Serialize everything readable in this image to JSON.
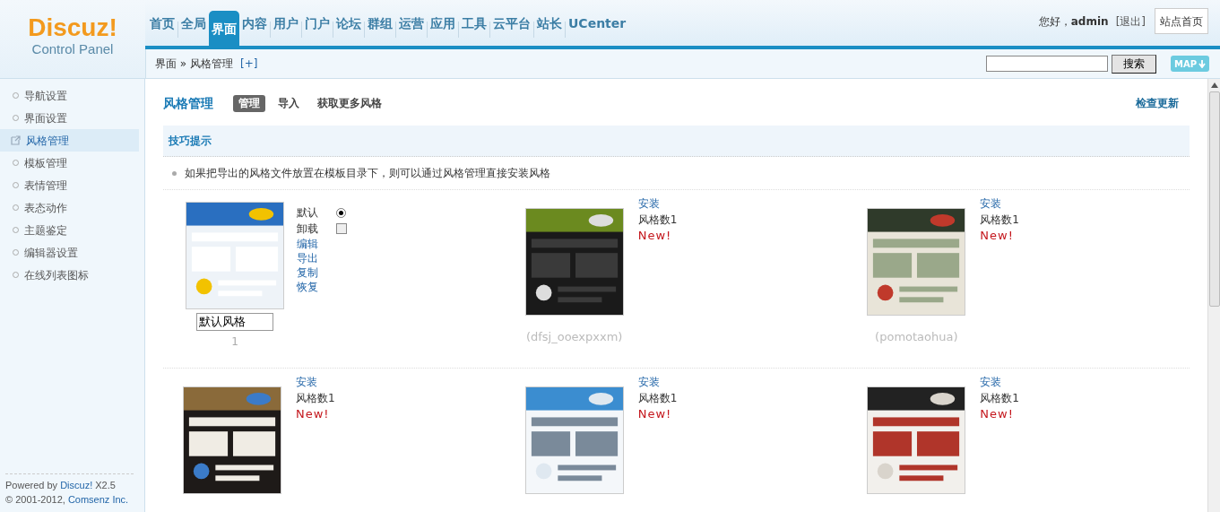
{
  "logo": {
    "title": "Discuz!",
    "subtitle": "Control Panel"
  },
  "nav": [
    {
      "label": "首页",
      "selected": false
    },
    {
      "label": "全局",
      "selected": false
    },
    {
      "label": "界面",
      "selected": true
    },
    {
      "label": "内容",
      "selected": false
    },
    {
      "label": "用户",
      "selected": false
    },
    {
      "label": "门户",
      "selected": false
    },
    {
      "label": "论坛",
      "selected": false
    },
    {
      "label": "群组",
      "selected": false
    },
    {
      "label": "运营",
      "selected": false
    },
    {
      "label": "应用",
      "selected": false
    },
    {
      "label": "工具",
      "selected": false
    },
    {
      "label": "云平台",
      "selected": false
    },
    {
      "label": "站长",
      "selected": false
    },
    {
      "label": "UCenter",
      "selected": false
    }
  ],
  "user": {
    "greeting": "您好，",
    "name": "admin",
    "logout": "[退出]",
    "site_home": "站点首页"
  },
  "breadcrumb": {
    "path": "界面 » 风格管理",
    "add": "[+]"
  },
  "search": {
    "button": "搜索",
    "map": "MAP"
  },
  "sidebar": {
    "items": [
      {
        "label": "导航设置",
        "selected": false
      },
      {
        "label": "界面设置",
        "selected": false
      },
      {
        "label": "风格管理",
        "selected": true
      },
      {
        "label": "模板管理",
        "selected": false
      },
      {
        "label": "表情管理",
        "selected": false
      },
      {
        "label": "表态动作",
        "selected": false
      },
      {
        "label": "主题鉴定",
        "selected": false
      },
      {
        "label": "编辑器设置",
        "selected": false
      },
      {
        "label": "在线列表图标",
        "selected": false
      }
    ],
    "footer": {
      "powered": "Powered by",
      "product": "Discuz!",
      "version": "X2.5",
      "copyright": "© 2001-2012,",
      "company": "Comsenz Inc."
    }
  },
  "page": {
    "title": "风格管理",
    "tabs": [
      {
        "label": "管理",
        "selected": true
      },
      {
        "label": "导入",
        "selected": false
      },
      {
        "label": "获取更多风格",
        "selected": false
      }
    ],
    "check_update": "检查更新"
  },
  "tips": {
    "title": "技巧提示",
    "items": [
      "如果把导出的风格文件放置在模板目录下，则可以通过风格管理直接安装风格"
    ]
  },
  "styles": [
    {
      "kind": "installed",
      "default_label": "默认",
      "default_selected": true,
      "uninstall_label": "卸载",
      "uninstall_checked": false,
      "actions": [
        "编辑",
        "导出",
        "复制",
        "恢复"
      ],
      "name": "默认风格",
      "id": "1"
    },
    {
      "kind": "available",
      "install": "安装",
      "count": "风格数1",
      "badge": "New!",
      "caption": "(dfsj_ooexpxxm)"
    },
    {
      "kind": "available",
      "install": "安装",
      "count": "风格数1",
      "badge": "New!",
      "caption": "(pomotaohua)"
    },
    {
      "kind": "available",
      "install": "安装",
      "count": "风格数1",
      "badge": "New!"
    },
    {
      "kind": "available",
      "install": "安装",
      "count": "风格数1",
      "badge": "New!"
    },
    {
      "kind": "available",
      "install": "安装",
      "count": "风格数1",
      "badge": "New!"
    }
  ]
}
